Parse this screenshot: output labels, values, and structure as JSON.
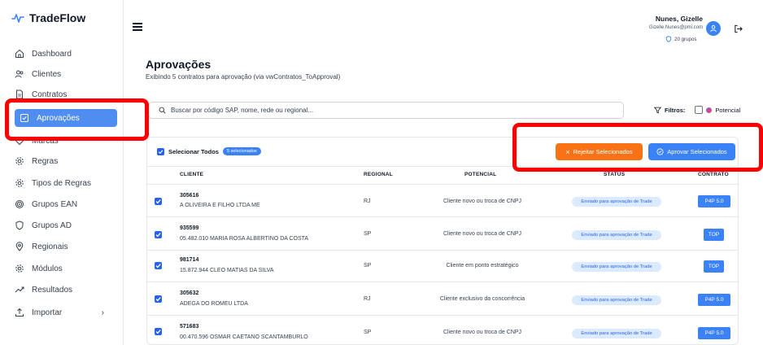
{
  "app": {
    "name": "TradeFlow"
  },
  "sidebar": {
    "items": [
      {
        "label": "Dashboard",
        "icon": "home-icon"
      },
      {
        "label": "Clientes",
        "icon": "users-icon"
      },
      {
        "label": "Contratos",
        "icon": "file-icon"
      },
      {
        "label": "Aprovações",
        "icon": "check-square-icon",
        "active": true
      },
      {
        "label": "Marcas",
        "icon": "tag-icon"
      },
      {
        "label": "Regras",
        "icon": "gear-icon"
      },
      {
        "label": "Tipos de Regras",
        "icon": "gear-icon"
      },
      {
        "label": "Grupos EAN",
        "icon": "target-icon"
      },
      {
        "label": "Grupos AD",
        "icon": "shield-icon"
      },
      {
        "label": "Regionais",
        "icon": "map-pin-icon"
      },
      {
        "label": "Módulos",
        "icon": "gear-icon"
      },
      {
        "label": "Resultados",
        "icon": "trend-icon"
      },
      {
        "label": "Importar",
        "icon": "upload-icon",
        "chevron": "›"
      }
    ]
  },
  "header": {
    "user_name": "Nunes, Gizelle",
    "user_email": "Gizelle.Nunes@pmi.com",
    "groups": "20 grupos"
  },
  "page": {
    "title": "Aprovações",
    "subtitle": "Exibindo 5 contratos para aprovação (via vwContratos_ToApproval)"
  },
  "search": {
    "placeholder": "Buscar por código SAP, nome, rede ou regional..."
  },
  "filters": {
    "label": "Filtros:",
    "option": "Potencial"
  },
  "toolbar": {
    "select_all": "Selecionar Todos",
    "selected_count": "5 selecionados",
    "reject": "Rejeitar Selecionados",
    "approve": "Aprovar Selecionados"
  },
  "table": {
    "headers": {
      "cliente": "CLIENTE",
      "regional": "REGIONAL",
      "potencial": "POTENCIAL",
      "status": "STATUS",
      "contrato": "CONTRATO"
    },
    "rows": [
      {
        "code": "305616",
        "name": "A OLIVEIRA E FILHO LTDA ME",
        "regional": "RJ",
        "potencial": "Cliente novo ou troca de CNPJ",
        "status": "Enviado para aprovação de Trade",
        "contrato": "P4P 5.0"
      },
      {
        "code": "935599",
        "name": "05.482.010 MARIA ROSA ALBERTINO DA COSTA",
        "regional": "SP",
        "potencial": "Cliente novo ou troca de CNPJ",
        "status": "Enviado para aprovação de Trade",
        "contrato": "TOP"
      },
      {
        "code": "981714",
        "name": "15.872.944 CLEO MATIAS DA SILVA",
        "regional": "SP",
        "potencial": "Cliente em ponto estratégico",
        "status": "Enviado para aprovação de Trade",
        "contrato": "TOP"
      },
      {
        "code": "305632",
        "name": "ADEGA DO ROMEU LTDA",
        "regional": "RJ",
        "potencial": "Cliente exclusivo da concorrência",
        "status": "Enviado para aprovação de Trade",
        "contrato": "P4P 5.0"
      },
      {
        "code": "571683",
        "name": "00.470.596 OSMAR CAETANO SCANTAMBURLO",
        "regional": "SP",
        "potencial": "Cliente novo ou troca de CNPJ",
        "status": "Enviado para aprovação de Trade",
        "contrato": "P4P 5.0"
      }
    ]
  },
  "colors": {
    "accent": "#3b82f6",
    "reject": "#f97316",
    "highlight": "#ff0000"
  }
}
